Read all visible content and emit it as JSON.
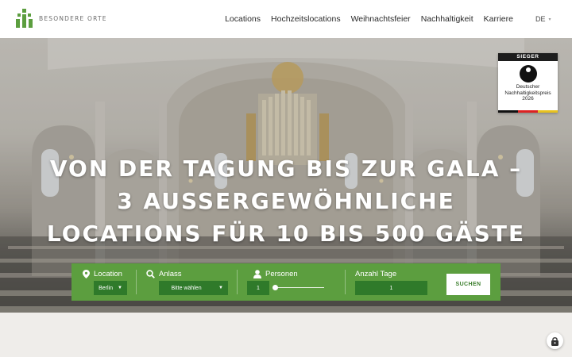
{
  "header": {
    "logo_text": "BESONDERE ORTE",
    "nav": [
      "Locations",
      "Hochzeitslocations",
      "Weihnachtsfeier",
      "Nachhaltigkeit",
      "Karriere"
    ],
    "language": "DE"
  },
  "hero": {
    "headline_lines": [
      "VON DER TAGUNG BIS ZUR GALA –",
      "3 AUSSERGEWÖHNLICHE",
      "LOCATIONS FÜR 10 BIS 500 GÄSTE"
    ]
  },
  "badge": {
    "label": "SIEGER",
    "text_line1": "Deutscher",
    "text_line2": "Nachhaltigkeitspreis",
    "year": "2026"
  },
  "search": {
    "location_label": "Location",
    "location_value": "Berlin",
    "anlass_label": "Anlass",
    "anlass_value": "Bitte wählen",
    "personen_label": "Personen",
    "personen_value": "1",
    "tage_label": "Anzahl Tage",
    "tage_value": "1",
    "submit_label": "SUCHEN",
    "accent_color": "#5c9e3f",
    "field_color": "#2f7a2a"
  }
}
